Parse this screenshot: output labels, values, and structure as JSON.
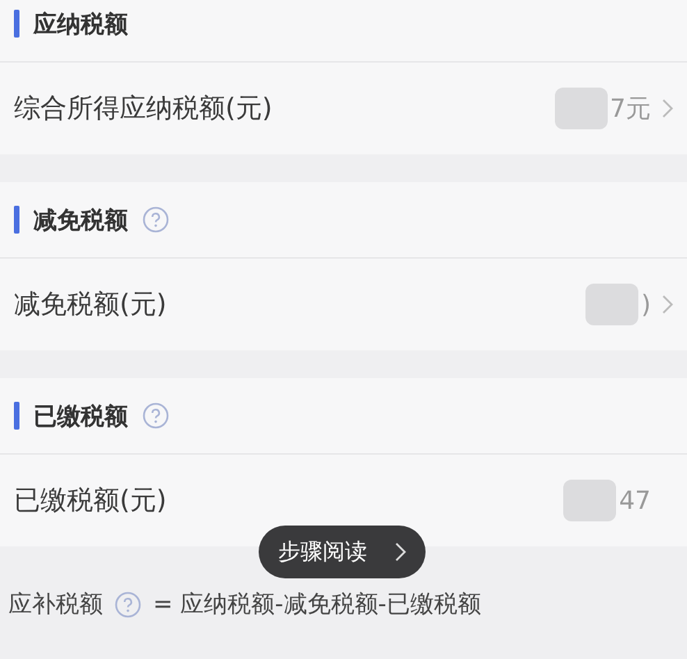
{
  "sections": [
    {
      "title": "应纳税额",
      "help": false,
      "rows": [
        {
          "label": "综合所得应纳税额(元)",
          "value": "7元",
          "redacted": true,
          "chevron": true
        }
      ]
    },
    {
      "title": "减免税额",
      "help": true,
      "rows": [
        {
          "label": "减免税额(元)",
          "value": ")",
          "redacted": true,
          "chevron": true
        }
      ]
    },
    {
      "title": "已缴税额",
      "help": true,
      "rows": [
        {
          "label": "已缴税额(元)",
          "value": "47",
          "redacted": true,
          "chevron": false
        }
      ]
    }
  ],
  "toast": {
    "text": "步骤阅读"
  },
  "footer": {
    "label": "应补税额",
    "help": true,
    "formula": "= 应纳税额-减免税额-已缴税额"
  }
}
